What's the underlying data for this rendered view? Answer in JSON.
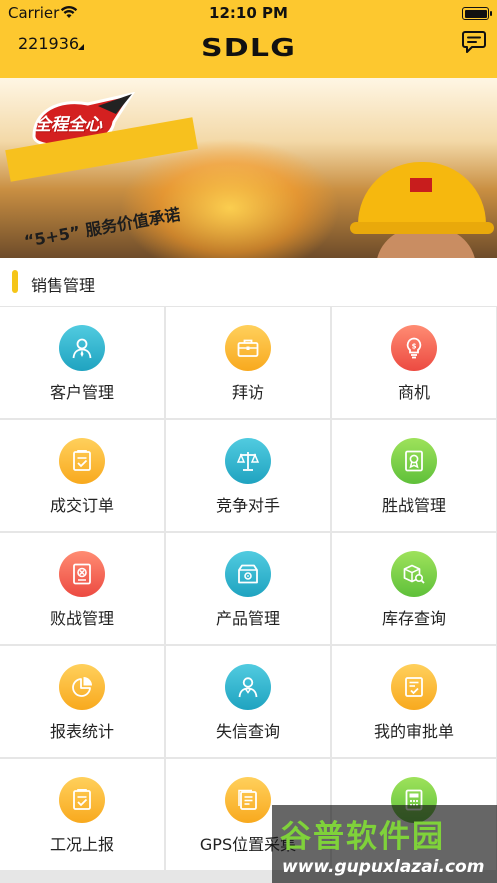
{
  "status_bar": {
    "carrier": "Carrier",
    "time": "12:10 PM"
  },
  "header": {
    "account": "221936",
    "logo": "SDLG",
    "message_icon": "chat-bubble-icon"
  },
  "banner": {
    "badge": "全程全心",
    "slogan": "“5+5” 服务价值承诺",
    "page_count": 2,
    "active_page": 1
  },
  "section": {
    "title": "销售管理"
  },
  "modules": [
    {
      "label": "客户管理",
      "icon": "customer-icon",
      "color": "#2fb4cf"
    },
    {
      "label": "拜访",
      "icon": "briefcase-icon",
      "color": "#f9b52c"
    },
    {
      "label": "商机",
      "icon": "lightbulb-icon",
      "color": "#f05a4a"
    },
    {
      "label": "成交订单",
      "icon": "order-icon",
      "color": "#f9b52c"
    },
    {
      "label": "竞争对手",
      "icon": "scale-icon",
      "color": "#2fb4cf"
    },
    {
      "label": "胜战管理",
      "icon": "award-icon",
      "color": "#6cc83f"
    },
    {
      "label": "败战管理",
      "icon": "lose-icon",
      "color": "#f05a4a"
    },
    {
      "label": "产品管理",
      "icon": "product-box-icon",
      "color": "#2fb4cf"
    },
    {
      "label": "库存查询",
      "icon": "inventory-icon",
      "color": "#6cc83f"
    },
    {
      "label": "报表统计",
      "icon": "pie-chart-icon",
      "color": "#f9b52c"
    },
    {
      "label": "失信查询",
      "icon": "person-icon",
      "color": "#2fb4cf"
    },
    {
      "label": "我的审批单",
      "icon": "approval-icon",
      "color": "#f9b52c"
    },
    {
      "label": "工况上报",
      "icon": "report-icon",
      "color": "#f9b52c"
    },
    {
      "label": "GPS位置采集",
      "icon": "gps-document-icon",
      "color": "#f9b52c"
    },
    {
      "label": "",
      "icon": "calculator-icon",
      "color": "#6cc83f"
    }
  ],
  "watermark": {
    "title": "谷普软件园",
    "url": "www.gupuxlazai.com"
  }
}
